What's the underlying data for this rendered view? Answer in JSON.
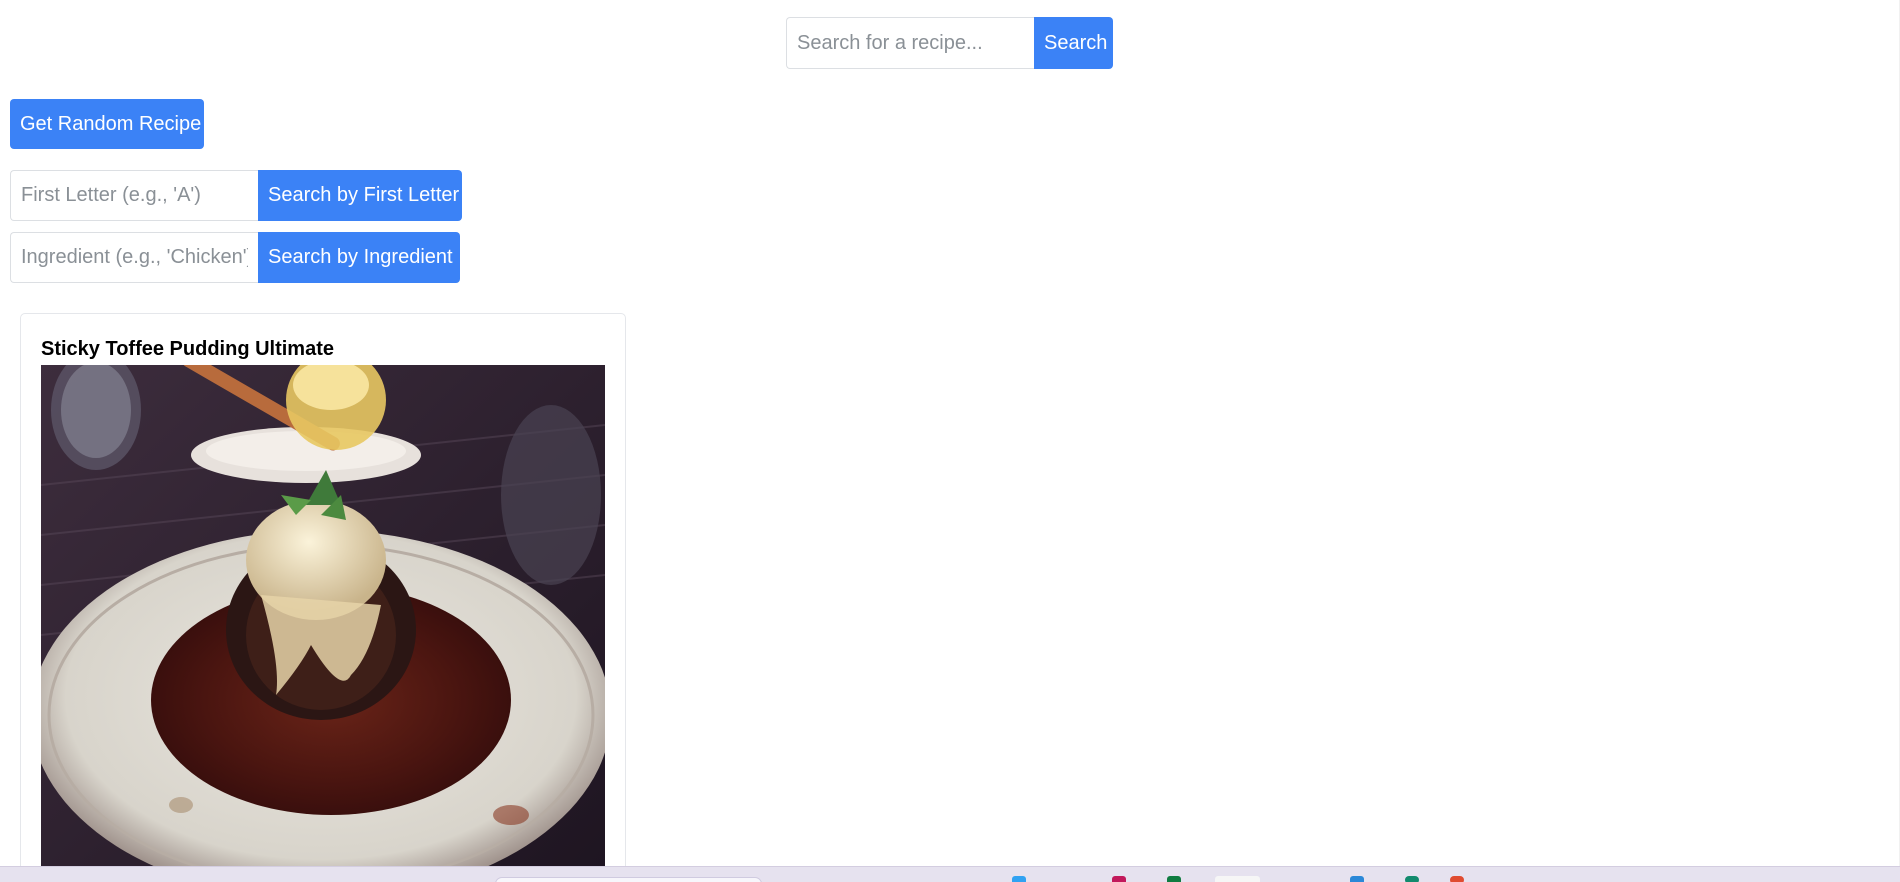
{
  "search": {
    "placeholder": "Search for a recipe...",
    "button_label": "Search"
  },
  "random": {
    "button_label": "Get Random Recipe"
  },
  "first_letter": {
    "placeholder": "First Letter (e.g., 'A')",
    "button_label": "Search by First Letter"
  },
  "ingredient": {
    "placeholder": "Ingredient (e.g., 'Chicken')",
    "button_label": "Search by Ingredient"
  },
  "recipe_card": {
    "title": "Sticky Toffee Pudding Ultimate"
  },
  "colors": {
    "accent": "#3b82f6"
  },
  "icons": [
    "search-bar",
    "taskbar-app-icon"
  ]
}
